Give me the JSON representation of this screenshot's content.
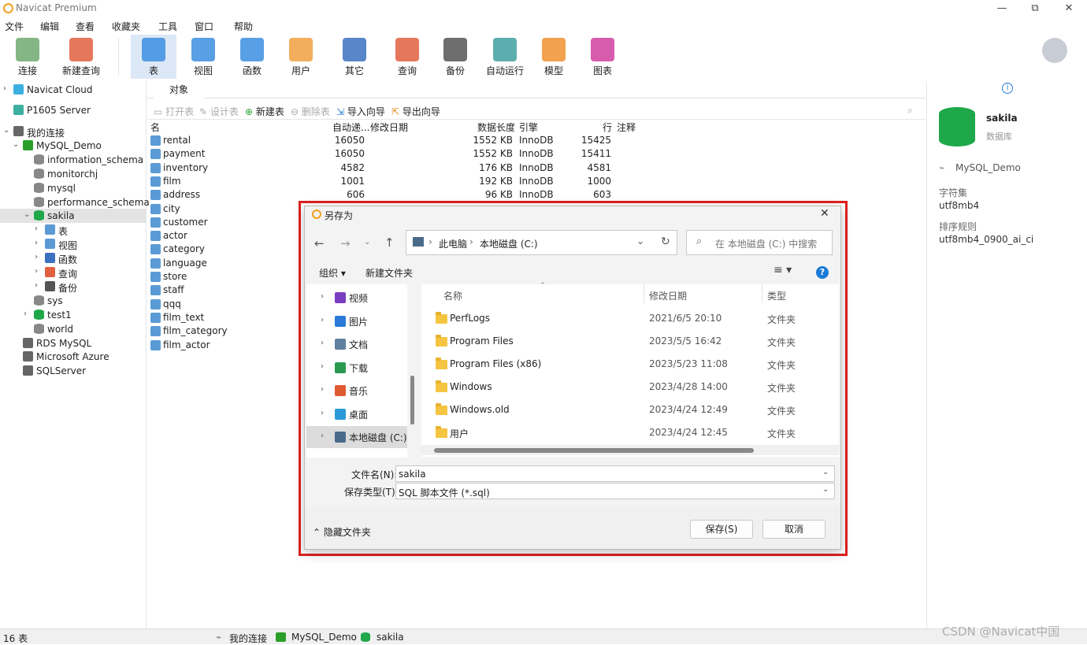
{
  "app": {
    "title": "Navicat Premium"
  },
  "window_controls": {
    "minimize": "—",
    "maximize": "⧉",
    "close": "✕"
  },
  "menu": [
    "文件",
    "编辑",
    "查看",
    "收藏夹",
    "工具",
    "窗口",
    "帮助"
  ],
  "toolbar": [
    {
      "label": "连接",
      "icon": "connect-icon",
      "color": "#6fa86f"
    },
    {
      "label": "新建查询",
      "icon": "new-query-icon",
      "color": "#e06040"
    },
    {
      "label": "表",
      "icon": "table-icon",
      "color": "#3c8ee0"
    },
    {
      "label": "视图",
      "icon": "view-icon",
      "color": "#3c8ee0"
    },
    {
      "label": "函数",
      "icon": "function-icon",
      "color": "#3c8ee0"
    },
    {
      "label": "用户",
      "icon": "user-icon",
      "color": "#f0a040"
    },
    {
      "label": "其它",
      "icon": "tools-icon",
      "color": "#3c70c0"
    },
    {
      "label": "查询",
      "icon": "query-icon",
      "color": "#e06040"
    },
    {
      "label": "备份",
      "icon": "backup-icon",
      "color": "#555555"
    },
    {
      "label": "自动运行",
      "icon": "robot-icon",
      "color": "#40a0a0"
    },
    {
      "label": "模型",
      "icon": "model-icon",
      "color": "#f09030"
    },
    {
      "label": "图表",
      "icon": "chart-icon",
      "color": "#d040a0"
    }
  ],
  "sidebar": [
    {
      "label": "Navicat Cloud",
      "arrow": "›",
      "icon": "cloud-icon",
      "color": "#3cb0e0",
      "indent": 0
    },
    {
      "label": "P1605 Server",
      "arrow": "",
      "icon": "server-icon",
      "color": "#3cb0a0",
      "indent": 0
    },
    {
      "label": "我的连接",
      "arrow": "⌄",
      "icon": "connection-icon",
      "color": "#666666",
      "indent": 0
    },
    {
      "label": "MySQL_Demo",
      "arrow": "⌄",
      "icon": "mysql-icon",
      "color": "#2aa02a",
      "indent": 1
    },
    {
      "label": "information_schema",
      "arrow": "",
      "icon": "database-icon",
      "color": "#888888",
      "indent": 2
    },
    {
      "label": "monitorchj",
      "arrow": "",
      "icon": "database-icon",
      "color": "#888888",
      "indent": 2
    },
    {
      "label": "mysql",
      "arrow": "",
      "icon": "database-icon",
      "color": "#888888",
      "indent": 2
    },
    {
      "label": "performance_schema",
      "arrow": "",
      "icon": "database-icon",
      "color": "#888888",
      "indent": 2
    },
    {
      "label": "sakila",
      "arrow": "⌄",
      "icon": "database-icon",
      "color": "#1fa84a",
      "indent": 2,
      "selected": true
    },
    {
      "label": "表",
      "arrow": "›",
      "icon": "table-icon",
      "color": "#5b9bd5",
      "indent": 3
    },
    {
      "label": "视图",
      "arrow": "›",
      "icon": "view-icon",
      "color": "#5b9bd5",
      "indent": 3
    },
    {
      "label": "函数",
      "arrow": "›",
      "icon": "function-icon",
      "color": "#3c70c0",
      "indent": 3
    },
    {
      "label": "查询",
      "arrow": "›",
      "icon": "query-icon",
      "color": "#e06040",
      "indent": 3
    },
    {
      "label": "备份",
      "arrow": "›",
      "icon": "backup-icon",
      "color": "#555555",
      "indent": 3
    },
    {
      "label": "sys",
      "arrow": "",
      "icon": "database-icon",
      "color": "#888888",
      "indent": 2
    },
    {
      "label": "test1",
      "arrow": "›",
      "icon": "database-icon",
      "color": "#1fa84a",
      "indent": 2
    },
    {
      "label": "world",
      "arrow": "",
      "icon": "database-icon",
      "color": "#888888",
      "indent": 2
    },
    {
      "label": "RDS MySQL",
      "arrow": "",
      "icon": "rds-icon",
      "color": "#666666",
      "indent": 1
    },
    {
      "label": "Microsoft Azure",
      "arrow": "",
      "icon": "azure-icon",
      "color": "#666666",
      "indent": 1
    },
    {
      "label": "SQLServer",
      "arrow": "",
      "icon": "sqlserver-icon",
      "color": "#666666",
      "indent": 1
    }
  ],
  "object_tab": "对象",
  "object_toolbar": [
    {
      "label": "打开表",
      "icon": "open-table-icon",
      "disabled": true
    },
    {
      "label": "设计表",
      "icon": "design-table-icon",
      "disabled": true
    },
    {
      "label": "新建表",
      "icon": "new-table-icon",
      "disabled": false
    },
    {
      "label": "删除表",
      "icon": "delete-table-icon",
      "disabled": true
    },
    {
      "label": "导入向导",
      "icon": "import-icon",
      "disabled": false
    },
    {
      "label": "导出向导",
      "icon": "export-icon",
      "disabled": false
    }
  ],
  "grid": {
    "headers": [
      "名",
      "自动递...",
      "修改日期",
      "数据长度",
      "引擎",
      "行",
      "注释"
    ],
    "rows": [
      [
        "rental",
        "16050",
        "",
        "1552 KB",
        "InnoDB",
        "15425"
      ],
      [
        "payment",
        "16050",
        "",
        "1552 KB",
        "InnoDB",
        "15411"
      ],
      [
        "inventory",
        "4582",
        "",
        "176 KB",
        "InnoDB",
        "4581"
      ],
      [
        "film",
        "1001",
        "",
        "192 KB",
        "InnoDB",
        "1000"
      ],
      [
        "address",
        "606",
        "",
        "96 KB",
        "InnoDB",
        "603"
      ],
      [
        "city",
        "",
        "",
        "",
        "",
        ""
      ],
      [
        "customer",
        "",
        "",
        "",
        "",
        ""
      ],
      [
        "actor",
        "",
        "",
        "",
        "",
        ""
      ],
      [
        "category",
        "",
        "",
        "",
        "",
        ""
      ],
      [
        "language",
        "",
        "",
        "",
        "",
        ""
      ],
      [
        "store",
        "",
        "",
        "",
        "",
        ""
      ],
      [
        "staff",
        "",
        "",
        "",
        "",
        ""
      ],
      [
        "qqq",
        "",
        "",
        "",
        "",
        ""
      ],
      [
        "film_text",
        "",
        "",
        "",
        "",
        ""
      ],
      [
        "film_category",
        "",
        "",
        "",
        "",
        ""
      ],
      [
        "film_actor",
        "",
        "",
        "",
        "",
        ""
      ]
    ]
  },
  "info": {
    "name": "sakila",
    "type": "数据库",
    "connection": "MySQL_Demo",
    "charset_label": "字符集",
    "charset": "utf8mb4",
    "collation_label": "排序规则",
    "collation": "utf8mb4_0900_ai_ci"
  },
  "status": {
    "count": "16 表",
    "crumb1": "我的连接",
    "crumb2": "MySQL_Demo",
    "crumb3": "sakila",
    "watermark": "CSDN @Navicat中国"
  },
  "dialog": {
    "title": "另存为",
    "path": [
      "此电脑",
      "本地磁盘 (C:)"
    ],
    "search_placeholder": "在 本地磁盘 (C:) 中搜索",
    "organize": "组织 ▾",
    "new_folder": "新建文件夹",
    "columns": [
      "名称",
      "修改日期",
      "类型"
    ],
    "nav": [
      {
        "label": "视频",
        "icon": "video-icon",
        "color": "#7a3fc0"
      },
      {
        "label": "图片",
        "icon": "picture-icon",
        "color": "#2a7ad8"
      },
      {
        "label": "文档",
        "icon": "document-icon",
        "color": "#6080a0"
      },
      {
        "label": "下载",
        "icon": "download-icon",
        "color": "#2a9a50"
      },
      {
        "label": "音乐",
        "icon": "music-icon",
        "color": "#e05a30"
      },
      {
        "label": "桌面",
        "icon": "desktop-icon",
        "color": "#2a9ad8"
      },
      {
        "label": "本地磁盘 (C:)",
        "icon": "drive-icon",
        "color": "#4a6a8a",
        "selected": true
      }
    ],
    "files": [
      {
        "name": "PerfLogs",
        "date": "2021/6/5 20:10",
        "type": "文件夹"
      },
      {
        "name": "Program Files",
        "date": "2023/5/5 16:42",
        "type": "文件夹"
      },
      {
        "name": "Program Files (x86)",
        "date": "2023/5/23 11:08",
        "type": "文件夹"
      },
      {
        "name": "Windows",
        "date": "2023/4/28 14:00",
        "type": "文件夹"
      },
      {
        "name": "Windows.old",
        "date": "2023/4/24 12:49",
        "type": "文件夹"
      },
      {
        "name": "用户",
        "date": "2023/4/24 12:45",
        "type": "文件夹"
      }
    ],
    "filename_label": "文件名(N):",
    "filename": "sakila",
    "filetype_label": "保存类型(T):",
    "filetype": "SQL 脚本文件 (*.sql)",
    "hide_folders": "隐藏文件夹",
    "save": "保存(S)",
    "cancel": "取消"
  }
}
